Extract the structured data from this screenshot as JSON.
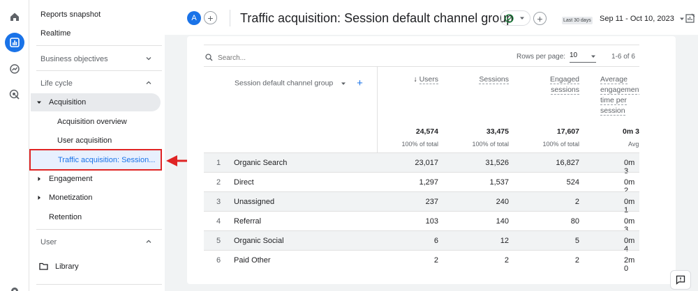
{
  "rail": {
    "icons": [
      "home-icon",
      "reports-icon",
      "explore-icon",
      "advertising-icon",
      "settings-icon"
    ]
  },
  "sidebar": {
    "reports_snapshot": "Reports snapshot",
    "realtime": "Realtime",
    "business_objectives": "Business objectives",
    "life_cycle": "Life cycle",
    "acquisition": "Acquisition",
    "acquisition_overview": "Acquisition overview",
    "user_acquisition": "User acquisition",
    "traffic_acquisition": "Traffic acquisition: Session...",
    "engagement": "Engagement",
    "monetization": "Monetization",
    "retention": "Retention",
    "user": "User",
    "library": "Library"
  },
  "header": {
    "avatar_letter": "A",
    "title": "Traffic acquisition: Session default channel group",
    "date_badge": "Last 30 days",
    "date_range": "Sep 11 - Oct 10, 2023"
  },
  "table": {
    "search_placeholder": "Search...",
    "rows_per_page_label": "Rows per page:",
    "rows_per_page_value": "10",
    "pagination": "1-6 of 6",
    "dimension_header": "Session default channel group",
    "add_dimension": "+",
    "columns": [
      {
        "label": "Users",
        "total": "24,574",
        "sub": "100% of total"
      },
      {
        "label": "Sessions",
        "total": "33,475",
        "sub": "100% of total"
      },
      {
        "label": "Engaged sessions",
        "total": "17,607",
        "sub": "100% of total"
      },
      {
        "label": "Average engagement time per session",
        "total": "0m 3",
        "sub": "Avg"
      }
    ],
    "rows": [
      {
        "idx": "1",
        "name": "Organic Search",
        "users": "23,017",
        "sessions": "31,526",
        "engaged": "16,827",
        "avg": "0m 3"
      },
      {
        "idx": "2",
        "name": "Direct",
        "users": "1,297",
        "sessions": "1,537",
        "engaged": "524",
        "avg": "0m 2"
      },
      {
        "idx": "3",
        "name": "Unassigned",
        "users": "237",
        "sessions": "240",
        "engaged": "2",
        "avg": "0m 1"
      },
      {
        "idx": "4",
        "name": "Referral",
        "users": "103",
        "sessions": "140",
        "engaged": "80",
        "avg": "0m 3"
      },
      {
        "idx": "5",
        "name": "Organic Social",
        "users": "6",
        "sessions": "12",
        "engaged": "5",
        "avg": "0m 4"
      },
      {
        "idx": "6",
        "name": "Paid Other",
        "users": "2",
        "sessions": "2",
        "engaged": "2",
        "avg": "2m 0"
      }
    ]
  },
  "colors": {
    "accent": "#1a73e8",
    "highlight_border": "#e02424",
    "arrow": "#e02424"
  }
}
